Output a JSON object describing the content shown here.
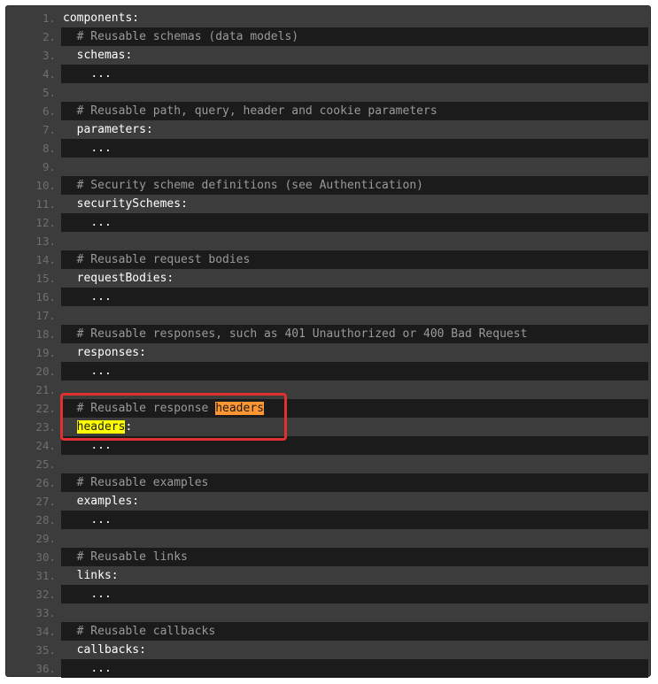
{
  "code": {
    "lines": [
      {
        "num": "1.",
        "indent": "",
        "parts": [
          {
            "t": "components",
            "cls": "key"
          },
          {
            "t": ":",
            "cls": "punct"
          }
        ]
      },
      {
        "num": "2.",
        "indent": "  ",
        "parts": [
          {
            "t": "# Reusable schemas (data models)",
            "cls": "comment"
          }
        ]
      },
      {
        "num": "3.",
        "indent": "  ",
        "parts": [
          {
            "t": "schemas",
            "cls": "key"
          },
          {
            "t": ":",
            "cls": "punct"
          }
        ]
      },
      {
        "num": "4.",
        "indent": "    ",
        "parts": [
          {
            "t": "...",
            "cls": "key"
          }
        ]
      },
      {
        "num": "5.",
        "indent": "",
        "parts": []
      },
      {
        "num": "6.",
        "indent": "  ",
        "parts": [
          {
            "t": "# Reusable path, query, header and cookie parameters",
            "cls": "comment"
          }
        ]
      },
      {
        "num": "7.",
        "indent": "  ",
        "parts": [
          {
            "t": "parameters",
            "cls": "key"
          },
          {
            "t": ":",
            "cls": "punct"
          }
        ]
      },
      {
        "num": "8.",
        "indent": "    ",
        "parts": [
          {
            "t": "...",
            "cls": "key"
          }
        ]
      },
      {
        "num": "9.",
        "indent": "",
        "parts": []
      },
      {
        "num": "10.",
        "indent": "  ",
        "parts": [
          {
            "t": "# Security scheme definitions (see Authentication)",
            "cls": "comment"
          }
        ]
      },
      {
        "num": "11.",
        "indent": "  ",
        "parts": [
          {
            "t": "securitySchemes",
            "cls": "key"
          },
          {
            "t": ":",
            "cls": "punct"
          }
        ]
      },
      {
        "num": "12.",
        "indent": "    ",
        "parts": [
          {
            "t": "...",
            "cls": "key"
          }
        ]
      },
      {
        "num": "13.",
        "indent": "",
        "parts": []
      },
      {
        "num": "14.",
        "indent": "  ",
        "parts": [
          {
            "t": "# Reusable request bodies",
            "cls": "comment"
          }
        ]
      },
      {
        "num": "15.",
        "indent": "  ",
        "parts": [
          {
            "t": "requestBodies",
            "cls": "key"
          },
          {
            "t": ":",
            "cls": "punct"
          }
        ]
      },
      {
        "num": "16.",
        "indent": "    ",
        "parts": [
          {
            "t": "...",
            "cls": "key"
          }
        ]
      },
      {
        "num": "17.",
        "indent": "",
        "parts": []
      },
      {
        "num": "18.",
        "indent": "  ",
        "parts": [
          {
            "t": "# Reusable responses, such as 401 Unauthorized or 400 Bad Request",
            "cls": "comment"
          }
        ]
      },
      {
        "num": "19.",
        "indent": "  ",
        "parts": [
          {
            "t": "responses",
            "cls": "key"
          },
          {
            "t": ":",
            "cls": "punct"
          }
        ]
      },
      {
        "num": "20.",
        "indent": "    ",
        "parts": [
          {
            "t": "...",
            "cls": "key"
          }
        ]
      },
      {
        "num": "21.",
        "indent": "",
        "parts": []
      },
      {
        "num": "22.",
        "indent": "  ",
        "parts": [
          {
            "t": "# Reusable response ",
            "cls": "comment"
          },
          {
            "t": "headers",
            "cls": "hl-orange"
          }
        ]
      },
      {
        "num": "23.",
        "indent": "  ",
        "parts": [
          {
            "t": "headers",
            "cls": "hl-yellow"
          },
          {
            "t": ":",
            "cls": "punct"
          }
        ]
      },
      {
        "num": "24.",
        "indent": "    ",
        "parts": [
          {
            "t": "...",
            "cls": "key"
          }
        ]
      },
      {
        "num": "25.",
        "indent": "",
        "parts": []
      },
      {
        "num": "26.",
        "indent": "  ",
        "parts": [
          {
            "t": "# Reusable examples",
            "cls": "comment"
          }
        ]
      },
      {
        "num": "27.",
        "indent": "  ",
        "parts": [
          {
            "t": "examples",
            "cls": "key"
          },
          {
            "t": ":",
            "cls": "punct"
          }
        ]
      },
      {
        "num": "28.",
        "indent": "    ",
        "parts": [
          {
            "t": "...",
            "cls": "key"
          }
        ]
      },
      {
        "num": "29.",
        "indent": "",
        "parts": []
      },
      {
        "num": "30.",
        "indent": "  ",
        "parts": [
          {
            "t": "# Reusable links",
            "cls": "comment"
          }
        ]
      },
      {
        "num": "31.",
        "indent": "  ",
        "parts": [
          {
            "t": "links",
            "cls": "key"
          },
          {
            "t": ":",
            "cls": "punct"
          }
        ]
      },
      {
        "num": "32.",
        "indent": "    ",
        "parts": [
          {
            "t": "...",
            "cls": "key"
          }
        ]
      },
      {
        "num": "33.",
        "indent": "",
        "parts": []
      },
      {
        "num": "34.",
        "indent": "  ",
        "parts": [
          {
            "t": "# Reusable callbacks",
            "cls": "comment"
          }
        ]
      },
      {
        "num": "35.",
        "indent": "  ",
        "parts": [
          {
            "t": "callbacks",
            "cls": "key"
          },
          {
            "t": ":",
            "cls": "punct"
          }
        ]
      },
      {
        "num": "36.",
        "indent": "    ",
        "parts": [
          {
            "t": "...",
            "cls": "key"
          }
        ]
      }
    ]
  },
  "colors": {
    "background": "#3c3c3c",
    "stripe": "#1b1b1b",
    "annotation_box": "#e03030",
    "highlight_current": "#ff9632",
    "highlight_match": "#ffff00"
  }
}
